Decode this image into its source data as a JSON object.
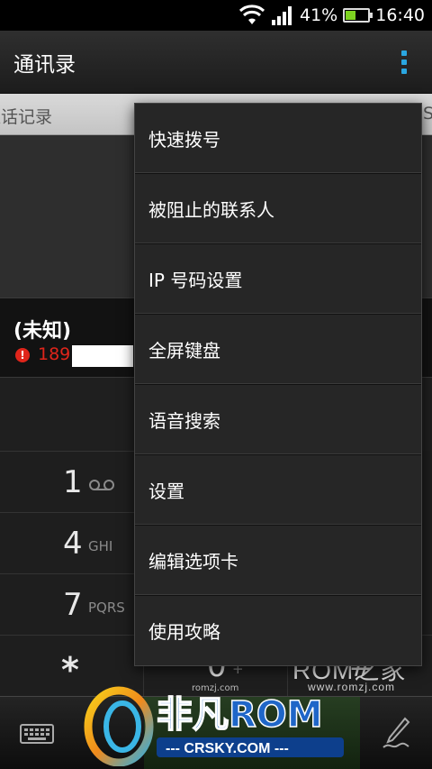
{
  "status_bar": {
    "battery_percent": "41%",
    "battery_level": 0.41,
    "time": "16:40",
    "icons": [
      "wifi-icon",
      "signal-icon",
      "battery-icon"
    ]
  },
  "action_bar": {
    "title": "通讯录",
    "overflow_icon": "overflow-menu-icon",
    "accent": "#2aa6e0"
  },
  "tabs": {
    "current_partial_label": "通话记录",
    "right_partial_label": "S"
  },
  "call_log": {
    "entry": {
      "name": "(未知)",
      "number_visible": "189",
      "status_icon": "missed-call-icon",
      "status_color": "#e0251b"
    }
  },
  "dialpad": {
    "keys": [
      {
        "digit": "1",
        "letters": "",
        "icon": "voicemail-icon"
      },
      {
        "digit": "4",
        "letters": "GHI"
      },
      {
        "digit": "7",
        "letters": "PQRS"
      },
      {
        "digit": "*",
        "letters": ""
      },
      {
        "digit": "0",
        "letters": "+"
      },
      {
        "digit": "#",
        "letters": ""
      }
    ]
  },
  "bottom_bar": {
    "left_icon": "keyboard-icon",
    "right_icon": "handwriting-pen-icon"
  },
  "overflow_menu": {
    "items": [
      {
        "label": "快速拨号"
      },
      {
        "label": "被阻止的联系人"
      },
      {
        "label": "IP 号码设置"
      },
      {
        "label": "全屏键盘"
      },
      {
        "label": "语音搜索"
      },
      {
        "label": "设置"
      },
      {
        "label": "编辑选项卡"
      },
      {
        "label": "使用攻略"
      }
    ]
  },
  "watermark": {
    "romzj_brand": "ROM之家",
    "romzj_url": "www.romzj.com",
    "romzj_small": "romzj.com",
    "feifan_brand": "非凡ROM",
    "crsky_url": "--- CRSKY.COM ---"
  }
}
